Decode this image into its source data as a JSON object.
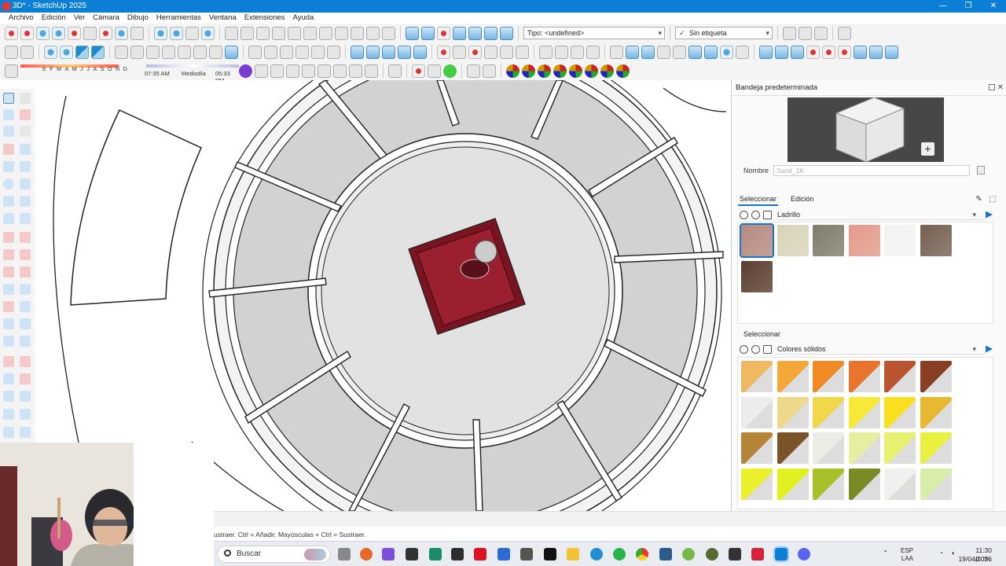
{
  "window": {
    "title": "3D* - SketchUp 2025",
    "buttons": [
      "—",
      "❐",
      "✕"
    ]
  },
  "menubar": {
    "items": [
      "Archivo",
      "Edición",
      "Ver",
      "Cámara",
      "Dibujo",
      "Herramientas",
      "Ventana",
      "Extensiones",
      "Ayuda"
    ]
  },
  "toolbar": {
    "tag_label": "Tipo: <undefined>",
    "layer_label": "Sin etiqueta",
    "months": "EFMAMJJASOND",
    "time_start": "07:35 AM",
    "time_mid": "Mediodía",
    "time_end": "05:33 PM"
  },
  "tray": {
    "title": "Bandeja predeterminada",
    "name_label": "Nombre",
    "name_value": "Sand_1K",
    "tab_select": "Seleccionar",
    "tab_edit": "Edición",
    "library1": "Ladrillo",
    "section2_label": "Seleccionar",
    "library2": "Colores sólidos"
  },
  "colors": {
    "brick_swatches": [
      "#b48a80",
      "#d8d4b8",
      "#7f7d6a",
      "#e39a8a",
      "#f2f2f2",
      "#75604f",
      "#5a3d2f"
    ],
    "solid_swatches": [
      "#f0b860",
      "#f5a83a",
      "#f08a24",
      "#e8742e",
      "#b9542e",
      "#8a3f24",
      "#ececec",
      "#eed88a",
      "#f0d84a",
      "#f8e838",
      "#f8e020",
      "#e8b830",
      "#b48438",
      "#7a5428",
      "#ecece6",
      "#e6eea0",
      "#e8f070",
      "#e8f040",
      "#eaf02a",
      "#e0f020",
      "#a8c028",
      "#7a8a24",
      "#f0f0ee",
      "#d8eea8"
    ],
    "accent": "#1a73c9"
  },
  "statusbar": {
    "message": "ustraer. Ctrl = Añadir. Mayúsculas + Ctrl = Sustraer."
  },
  "taskbar": {
    "search_placeholder": "Buscar",
    "lang": "ESP",
    "lang_sub": "LAA",
    "time": "11:30 p. m.",
    "date": "19/04/2026"
  }
}
